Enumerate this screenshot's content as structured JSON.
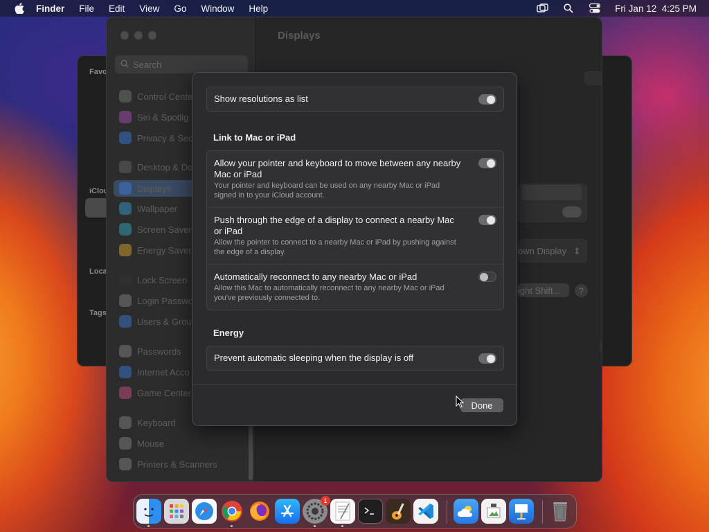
{
  "menubar": {
    "app_name": "Finder",
    "menus": [
      "File",
      "Edit",
      "View",
      "Go",
      "Window",
      "Help"
    ],
    "datetime": "Fri Jan 12  4:25 PM"
  },
  "finder": {
    "labels": [
      "Favo",
      "iClou",
      "Loca",
      "Tags"
    ]
  },
  "settings": {
    "title": "Displays",
    "search_placeholder": "Search",
    "sidebar_items": [
      "Control Cente",
      "Siri & Spotlig",
      "Privacy & Sec",
      "Desktop & Do",
      "Displays",
      "Wallpaper",
      "Screen Saver",
      "Energy Saver",
      "Lock Screen",
      "Login Passwo",
      "Users & Grou",
      "Passwords",
      "Internet Acco",
      "Game Center",
      "Keyboard",
      "Mouse",
      "Printers & Scanners"
    ],
    "bg_display_select": "own Display",
    "bg_night_shift": "ight Shift...",
    "bg_help": "?"
  },
  "sheet": {
    "show_resolutions": {
      "label": "Show resolutions as list",
      "on": true
    },
    "link_section_title": "Link to Mac or iPad",
    "link_rows": [
      {
        "title": "Allow your pointer and keyboard to move between any nearby Mac or iPad",
        "desc": "Your pointer and keyboard can be used on any nearby Mac or iPad signed in to your iCloud account.",
        "on": true
      },
      {
        "title": "Push through the edge of a display to connect a nearby Mac or iPad",
        "desc": "Allow the pointer to connect to a nearby Mac or iPad by pushing against the edge of a display.",
        "on": true
      },
      {
        "title": "Automatically reconnect to any nearby Mac or iPad",
        "desc": "Allow this Mac to automatically reconnect to any nearby Mac or iPad you've previously connected to.",
        "on": false
      }
    ],
    "energy_section_title": "Energy",
    "prevent_sleep": {
      "label": "Prevent automatic sleeping when the display is off",
      "on": true
    },
    "done_label": "Done"
  },
  "dock": {
    "apps": [
      "finder-icon",
      "launchpad-icon",
      "safari-icon",
      "chrome-icon",
      "firefox-icon",
      "app-store-icon",
      "system-settings-icon",
      "textedit-icon",
      "terminal-icon",
      "garageband-icon",
      "vscode-icon",
      "weather-icon",
      "preview-icon",
      "keynote-icon",
      "trash-icon"
    ],
    "settings_badge": "1"
  }
}
